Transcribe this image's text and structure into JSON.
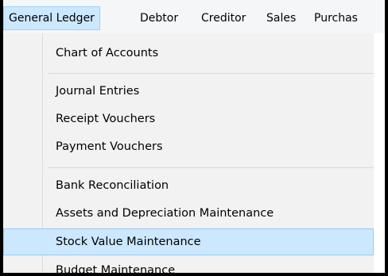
{
  "menubar": {
    "items": [
      {
        "label": "General Ledger"
      },
      {
        "label": "Debtor"
      },
      {
        "label": "Creditor"
      },
      {
        "label": "Sales"
      },
      {
        "label": "Purchas"
      }
    ]
  },
  "dropdown": {
    "items": [
      {
        "label": "Chart of Accounts"
      },
      {
        "label": "Journal Entries"
      },
      {
        "label": "Receipt Vouchers"
      },
      {
        "label": "Payment Vouchers"
      },
      {
        "label": "Bank Reconciliation"
      },
      {
        "label": "Assets and Depreciation Maintenance"
      },
      {
        "label": "Stock Value Maintenance"
      },
      {
        "label": "Budget Maintenance"
      }
    ],
    "highlighted_item": "Stock Value Maintenance"
  },
  "colors": {
    "highlight": "#cce8ff",
    "highlight_border": "#99c9ef",
    "menu_background": "#f2f2f2",
    "frame": "#000000"
  }
}
